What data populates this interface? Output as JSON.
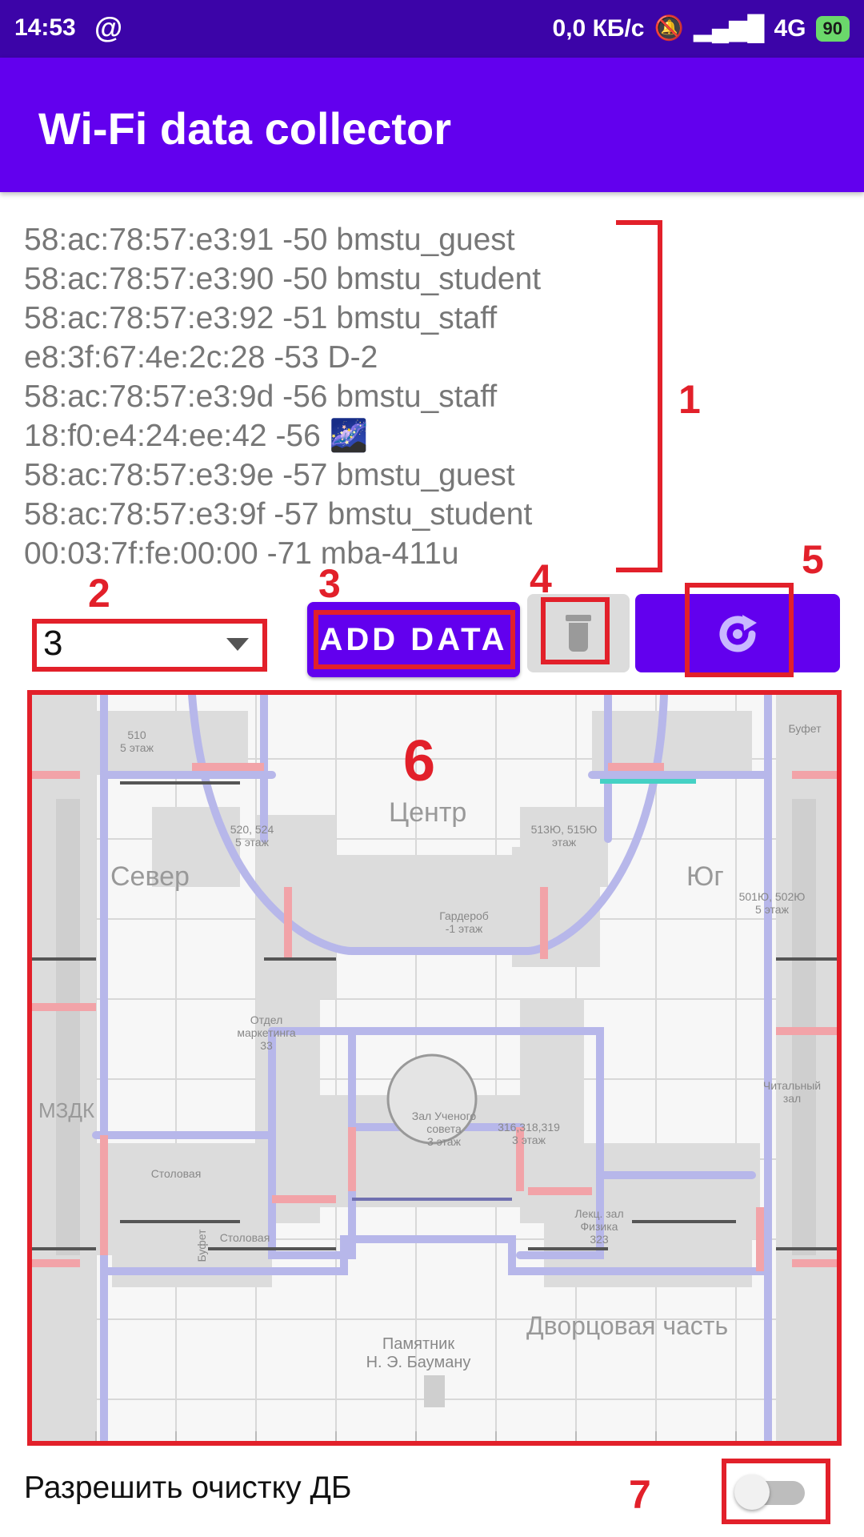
{
  "status_bar": {
    "time": "14:53",
    "at_symbol": "@",
    "network_speed": "0,0 КБ/с",
    "network_type": "4G",
    "battery": "90"
  },
  "app": {
    "title": "Wi-Fi data collector"
  },
  "wifi_networks": [
    "58:ac:78:57:e3:91 -50 bmstu_guest",
    "58:ac:78:57:e3:90 -50 bmstu_student",
    "58:ac:78:57:e3:92 -51 bmstu_staff",
    "e8:3f:67:4e:2c:28 -53 D-2",
    "58:ac:78:57:e3:9d -56 bmstu_staff",
    "18:f0:e4:24:ee:42 -56 🌌",
    "58:ac:78:57:e3:9e -57 bmstu_guest",
    "58:ac:78:57:e3:9f -57 bmstu_student",
    "00:03:7f:fe:00:00 -71 mba-411u"
  ],
  "controls": {
    "floor_spinner_value": "3",
    "add_data_label": "ADD DATA",
    "allow_db_clear_label": "Разрешить очистку ДБ",
    "allow_db_clear_enabled": false
  },
  "annotations": [
    "1",
    "2",
    "3",
    "4",
    "5",
    "6",
    "7"
  ],
  "map": {
    "labels": {
      "center": "Центр",
      "north": "Север",
      "south": "Юг",
      "mzdk": "МЗДК",
      "palace": "Дворцовая часть",
      "monument": "Памятник\nН. Э. Бауману",
      "room_510": "510\n5 этаж",
      "room_520": "520, 524\n5 этаж",
      "room_513": "513Ю, 515Ю\nэтаж",
      "room_501": "501Ю, 502Ю\n5 этаж",
      "wardrobe": "Гардероб\n-1 этаж",
      "marketing": "Отдел\nмаркетинга\n33",
      "council": "Зал Ученого\nсовета\n3 этаж",
      "room_316": "316,318,319\n3 этаж",
      "canteen": "Столовая",
      "canteen2": "Столовая",
      "buffet": "Буфет",
      "lecture": "Лекц. зал\nФизика\n323",
      "reading": "Читальный\nзал",
      "buffet2": "Буфет"
    },
    "colors": {
      "corridor": "#b7b7ea",
      "door": "#f2a3a8",
      "teal": "#45d1c4"
    }
  }
}
